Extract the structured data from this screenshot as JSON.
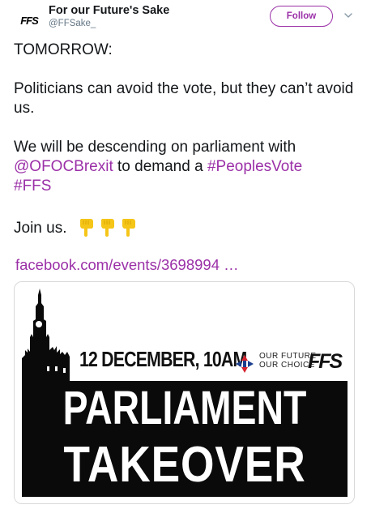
{
  "account": {
    "display_name": "For our Future's Sake",
    "handle": "@FFSake_",
    "avatar_text": "FFS"
  },
  "actions": {
    "follow_label": "Follow"
  },
  "tweet": {
    "line_tomorrow": "TOMORROW:",
    "line_politicians": "Politicians can avoid the vote, but they can’t avoid us.",
    "line_descending_pre": "We will be descending on parliament with ",
    "mention": "@OFOCBrexit",
    "line_descending_mid": " to demand a ",
    "hashtag_vote": "#PeoplesVote",
    "hashtag_ffs": "#FFS",
    "join_text": "Join us.",
    "emoji": [
      "pointing-down-emoji",
      "pointing-down-emoji",
      "pointing-down-emoji"
    ]
  },
  "link": {
    "url_text": "facebook.com/events/3698994 …"
  },
  "card": {
    "date_text": "12 DECEMBER, 10AM",
    "ofoc_line1": "OUR FUTURE",
    "ofoc_line2": "OUR CHOICE",
    "ffs_logo": "FFS",
    "headline_1": "PARLIAMENT",
    "headline_2": "TAKEOVER"
  },
  "colors": {
    "accent": "#9b30a8",
    "text": "#14171a",
    "muted": "#657786",
    "emoji": "#f5c518"
  }
}
